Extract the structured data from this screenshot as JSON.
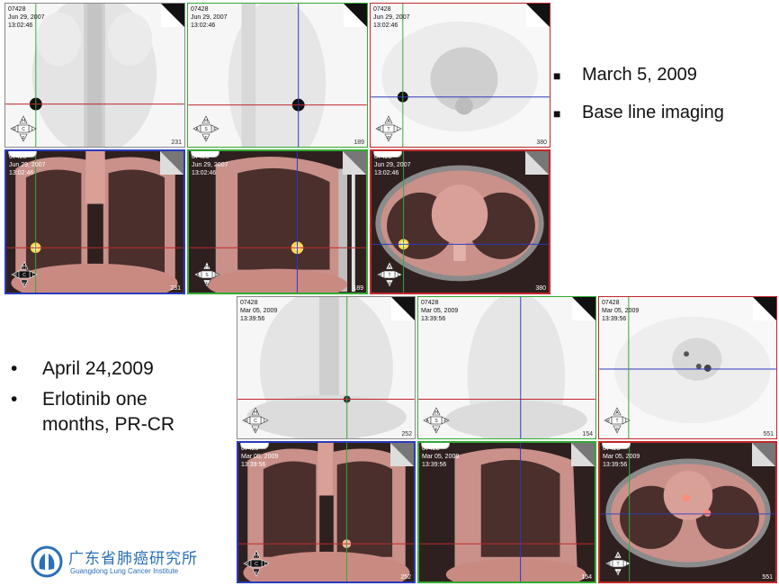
{
  "top_bullets": [
    {
      "text": "March 5, 2009"
    },
    {
      "text": "Base line imaging"
    }
  ],
  "left_bullets": [
    {
      "line1": "April 24,2009"
    },
    {
      "line1": "Erlotinib one",
      "line2": "months, PR-CR"
    }
  ],
  "logo": {
    "chinese": "广东省肺癌研究所",
    "english": "Guangdong Lung Cancer Institute"
  },
  "baseline": {
    "id": "07428",
    "date": "Jun 29, 2007",
    "time": "13:02:46",
    "slices": [
      "231",
      "189",
      "380",
      "231",
      "189",
      "380"
    ]
  },
  "followup": {
    "ids": [
      "07428",
      "07428",
      "07428",
      "07428",
      "07428",
      "07428"
    ],
    "date": "Mar 05, 2009",
    "time": "13:39:56",
    "slices": [
      "252",
      "154",
      "551",
      "252",
      "154",
      "551"
    ]
  },
  "compass_letters": {
    "coronal": [
      "H",
      "R",
      "C",
      "L",
      "F"
    ],
    "sagittal": [
      "H",
      "A",
      "S",
      "P",
      "F"
    ],
    "axial": [
      "A",
      "R",
      "T",
      "L",
      "P"
    ]
  },
  "colors": {
    "crosshair_red": "#c0282a",
    "crosshair_green": "#33aa33",
    "crosshair_blue": "#2b3bbb",
    "fusion_bg": "#3a2a28",
    "pet_bg": "#f4f4f4"
  }
}
